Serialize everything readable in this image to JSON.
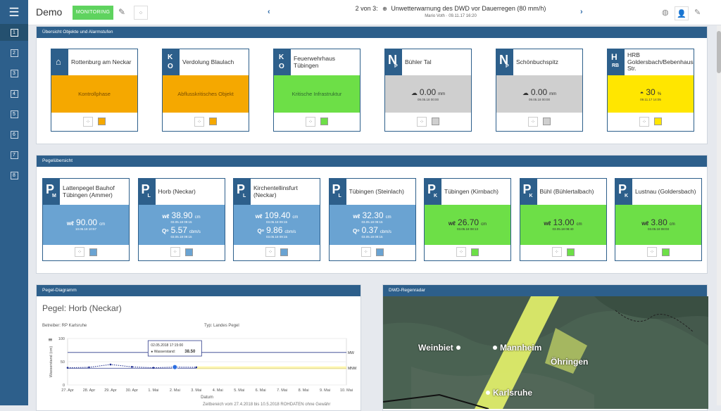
{
  "app": {
    "title": "Demo",
    "mode_button": "MONITORING"
  },
  "header": {
    "counter": "2 von 3:",
    "alert_title": "Unwetterwarnung des DWD vor Dauerregen (80 mm/h)",
    "alert_sub": "Mario Voth · 09.11.17 16:20"
  },
  "sidebar": {
    "items": [
      "1",
      "2",
      "3",
      "4",
      "5",
      "6",
      "7",
      "8"
    ]
  },
  "objects_panel": {
    "title": "Übersicht Objekte und Alarmstufen",
    "cards": [
      {
        "letter": "home",
        "name": "Rottenburg am Neckar",
        "status": "Kontrollphase",
        "color": "#f5a800"
      },
      {
        "letter": "KO",
        "name": "Verdolung Blaulach",
        "status": "Abflusskritisches Objekt",
        "color": "#f5a800"
      },
      {
        "letter": "KO",
        "name": "Feuerwehrhaus Tübingen",
        "status": "Kritische Infrastruktur",
        "color": "#6ddf47"
      },
      {
        "letter": "N",
        "sub": "P",
        "name": "Bühler Tal",
        "value": "0.00",
        "unit": "mm",
        "date": "09.05.18 00:00",
        "color": "#cfcfcf"
      },
      {
        "letter": "N",
        "sub": "P",
        "name": "Schönbuchspitz",
        "value": "0.00",
        "unit": "mm",
        "date": "09.05.18 00:00",
        "color": "#cfcfcf"
      },
      {
        "letter": "HRB",
        "name": "HRB Goldersbach/Bebenhausen Str.",
        "value": "30",
        "unit": "%",
        "date": "09.11.17 14:05",
        "color": "#ffe600"
      }
    ]
  },
  "gauges_panel": {
    "title": "Pegelübersicht",
    "cards": [
      {
        "letter": "P",
        "sub": "M",
        "name": "Lattenpegel Bauhof Tübingen (Ammer)",
        "w": "90.00",
        "w_unit": "cm",
        "w_date": "10.05.18 10:57",
        "color": "#6aa3d2"
      },
      {
        "letter": "P",
        "sub": "L",
        "name": "Horb (Neckar)",
        "w": "38.90",
        "w_unit": "cm",
        "w_date": "03.05.18 09:15",
        "q": "5.57",
        "q_unit": "cbm/s",
        "q_date": "03.05.18 09:15",
        "color": "#6aa3d2"
      },
      {
        "letter": "P",
        "sub": "L",
        "name": "Kirchentellinsfurt (Neckar)",
        "w": "109.40",
        "w_unit": "cm",
        "w_date": "03.05.18 09:15",
        "q": "9.86",
        "q_unit": "cbm/s",
        "q_date": "03.05.18 09:15",
        "color": "#6aa3d2"
      },
      {
        "letter": "P",
        "sub": "L",
        "name": "Tübingen (Steinlach)",
        "w": "32.30",
        "w_unit": "cm",
        "w_date": "03.05.18 09:15",
        "q": "0.37",
        "q_unit": "cbm/s",
        "q_date": "03.05.18 09:15",
        "color": "#6aa3d2"
      },
      {
        "letter": "P",
        "sub": "K",
        "name": "Tübingen (Kirnbach)",
        "w": "26.70",
        "w_unit": "cm",
        "w_date": "03.05.18 08:13",
        "color": "#6ddf47"
      },
      {
        "letter": "P",
        "sub": "K",
        "name": "Bühl (Bühlertalbach)",
        "w": "13.00",
        "w_unit": "cm",
        "w_date": "03.05.18 08:40",
        "color": "#6ddf47"
      },
      {
        "letter": "P",
        "sub": "K",
        "name": "Lustnau (Goldersbach)",
        "w": "3.80",
        "w_unit": "cm",
        "w_date": "03.05.18 08:03",
        "color": "#6ddf47"
      }
    ]
  },
  "diagram": {
    "panel_title": "Pegel-Diagramm",
    "title": "Pegel: Horb (Neckar)",
    "operator": "Betreiber: RP Karlsruhe",
    "type": "Typ: Landes Pegel",
    "footnote": "Zeitbereich vom 27.4.2018 bis 10.5.2018 ROHDATEN ohne Gewähr",
    "tooltip_date": "02.05.2018 17:15:00",
    "tooltip_label": "● Wasserstand:",
    "tooltip_value": "38.50"
  },
  "radar": {
    "panel_title": "DWD-Regenradar",
    "cities": [
      "Weinbiet",
      "Mannheim",
      "Öhringen",
      "Karlsruhe"
    ]
  },
  "chart_data": {
    "type": "line",
    "title": "",
    "xlabel": "Datum",
    "ylabel": "Wasserstand (cm)",
    "ylim": [
      0,
      100
    ],
    "yticks": [
      0,
      50,
      100
    ],
    "xticks": [
      "27. Apr",
      "28. Apr",
      "29. Apr",
      "30. Apr",
      "1. Mai",
      "2. Mai",
      "3. Mai",
      "4. Mai",
      "5. Mai",
      "6. Mai",
      "7. Mai",
      "8. Mai",
      "9. Mai",
      "10. Mai"
    ],
    "thresholds": [
      {
        "name": "MW",
        "value": 70
      },
      {
        "name": "MNW",
        "value": 36
      }
    ],
    "series": [
      {
        "name": "Wasserstand",
        "x": [
          "27. Apr",
          "28. Apr",
          "29. Apr",
          "30. Apr",
          "1. Mai",
          "2. Mai",
          "3. Mai"
        ],
        "values": [
          37,
          38,
          44,
          39,
          37,
          38.5,
          38
        ]
      }
    ]
  }
}
